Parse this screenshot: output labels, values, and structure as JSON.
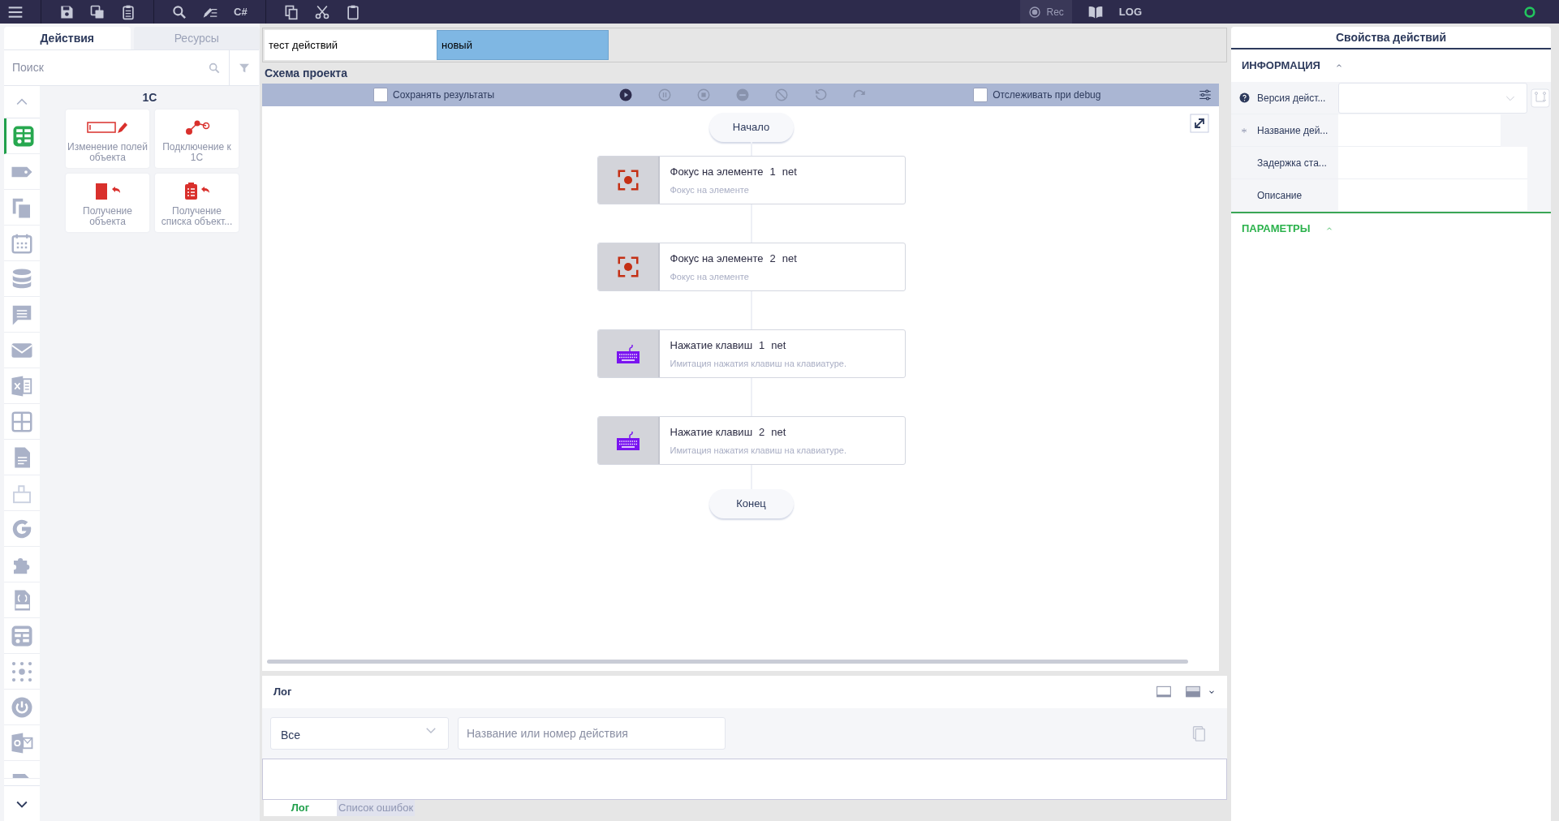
{
  "toolbar": {
    "items": [
      {
        "kind": "menu"
      },
      {
        "kind": "sep"
      },
      {
        "kind": "save"
      },
      {
        "kind": "save-copy"
      },
      {
        "kind": "clipboard-list"
      },
      {
        "kind": "sep"
      },
      {
        "kind": "search"
      },
      {
        "kind": "edit-list"
      },
      {
        "kind": "text",
        "label": "C#"
      },
      {
        "kind": "sep"
      },
      {
        "kind": "copy"
      },
      {
        "kind": "cut"
      },
      {
        "kind": "paste"
      }
    ],
    "right": [
      {
        "kind": "rec",
        "label": "Rec"
      },
      {
        "kind": "book"
      },
      {
        "kind": "text",
        "label": "LOG"
      }
    ],
    "status_on": true
  },
  "left_panel": {
    "tabs": [
      {
        "label": "Действия",
        "selected": true
      },
      {
        "label": "Ресурсы",
        "selected": false
      }
    ],
    "search": {
      "placeholder": "Поиск"
    },
    "categories": [
      {
        "kind": "table",
        "selected": true
      },
      {
        "kind": "tag",
        "selected": false
      },
      {
        "kind": "copy",
        "selected": false
      },
      {
        "kind": "calendar",
        "selected": false
      },
      {
        "kind": "database",
        "selected": false
      },
      {
        "kind": "chat",
        "selected": false
      },
      {
        "kind": "mail",
        "selected": false
      },
      {
        "kind": "excel",
        "selected": false
      },
      {
        "kind": "grid",
        "selected": false
      },
      {
        "kind": "document",
        "selected": false
      },
      {
        "kind": "box",
        "selected": false
      },
      {
        "kind": "g",
        "selected": false
      },
      {
        "kind": "puzzle",
        "selected": false
      },
      {
        "kind": "json",
        "selected": false
      },
      {
        "kind": "form",
        "selected": false
      },
      {
        "kind": "dots",
        "selected": false
      },
      {
        "kind": "power",
        "selected": false
      },
      {
        "kind": "outlook",
        "selected": false
      },
      {
        "kind": "partial",
        "selected": false
      }
    ],
    "group_title": "1С",
    "actions": [
      {
        "kind": "field-edit",
        "label": "Изменение полей объекта"
      },
      {
        "kind": "connect",
        "label": "Подключение к 1С"
      },
      {
        "kind": "get-object",
        "label": "Получение объекта"
      },
      {
        "kind": "get-list",
        "label": "Получение списка объект..."
      }
    ]
  },
  "editor": {
    "tabs": [
      {
        "label": "тест действий",
        "selected": false
      },
      {
        "label": "новый",
        "selected": true
      }
    ],
    "schema_title": "Схема проекта",
    "controls": [
      {
        "kind": "checkbox",
        "label": "Сохранять результаты",
        "checked": false
      },
      {
        "kind": "play",
        "disabled": false
      },
      {
        "kind": "pause",
        "disabled": true
      },
      {
        "kind": "stop",
        "disabled": true
      },
      {
        "kind": "minus",
        "disabled": true
      },
      {
        "kind": "ban",
        "disabled": true
      },
      {
        "kind": "undo",
        "disabled": true
      },
      {
        "kind": "redo",
        "disabled": true
      },
      {
        "kind": "checkbox",
        "label": "Отслеживать при debug",
        "checked": false
      },
      {
        "kind": "settings"
      }
    ],
    "start": "Начало",
    "end": "Конец",
    "nodes": [
      {
        "kind": "focus",
        "title": "Фокус на элементе",
        "number": "1",
        "suffix": "net",
        "description": "Фокус на элементе"
      },
      {
        "kind": "focus",
        "title": "Фокус на элементе",
        "number": "2",
        "suffix": "net",
        "description": "Фокус на элементе"
      },
      {
        "kind": "keyboard",
        "title": "Нажатие клавиш",
        "number": "1",
        "suffix": "net",
        "description": "Имитация нажатия клавиш на клавиатуре."
      },
      {
        "kind": "keyboard",
        "title": "Нажатие клавиш",
        "number": "2",
        "suffix": "net",
        "description": "Имитация нажатия клавиш на клавиатуре."
      }
    ]
  },
  "log": {
    "title": "Лог",
    "filter": {
      "value": "Все"
    },
    "search": {
      "placeholder": "Название или номер действия"
    },
    "tabs": [
      {
        "label": "Лог",
        "selected": true
      },
      {
        "label": "Список ошибок",
        "selected": false
      }
    ]
  },
  "properties": {
    "title": "Свойства действий",
    "sections": [
      {
        "title": "ИНФОРМАЦИЯ",
        "kind": "info",
        "expanded": true,
        "rows": [
          {
            "label": "Версия дейст...",
            "kind": "help-dropdown"
          },
          {
            "label": "Название дей...",
            "kind": "required-text"
          },
          {
            "label": "Задержка ста...",
            "kind": "text"
          },
          {
            "label": "Описание",
            "kind": "text"
          }
        ]
      },
      {
        "title": "ПАРАМЕТРЫ",
        "kind": "params",
        "expanded": true
      }
    ]
  }
}
